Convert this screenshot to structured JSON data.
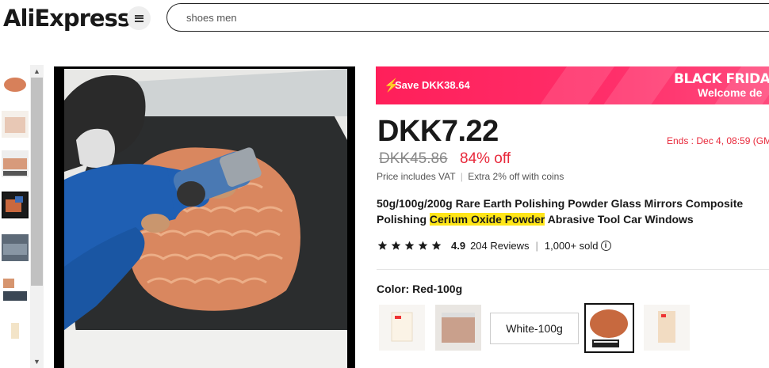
{
  "header": {
    "logo": "AliExpress",
    "search_value": "shoes men"
  },
  "banner": {
    "save_text": "Save DKK38.64",
    "promo_line1": "BLACK FRIDA",
    "promo_line2": "Welcome de"
  },
  "product": {
    "price": "DKK7.22",
    "original_price": "DKK45.86",
    "discount": "84% off",
    "ends": "Ends :  Dec 4, 08:59 (GM",
    "vat_note": "Price includes VAT",
    "coins_note": "Extra 2% off with coins",
    "title_part1": "50g/100g/200g Rare Earth Polishing Powder Glass Mirrors Composite Polishing ",
    "title_highlight": "Cerium Oxide Powder",
    "title_part2": " Abrasive Tool Car Windows",
    "rating": "4.9",
    "reviews": "204 Reviews",
    "sold": "1,000+ sold",
    "stars": 5
  },
  "options": {
    "color_label": "Color: Red-100g",
    "text_option": "White-100g",
    "selected": "Red-100g"
  },
  "colors": {
    "accent": "#e8293b",
    "banner": "#ff2f6a",
    "highlight": "#ffe619"
  }
}
